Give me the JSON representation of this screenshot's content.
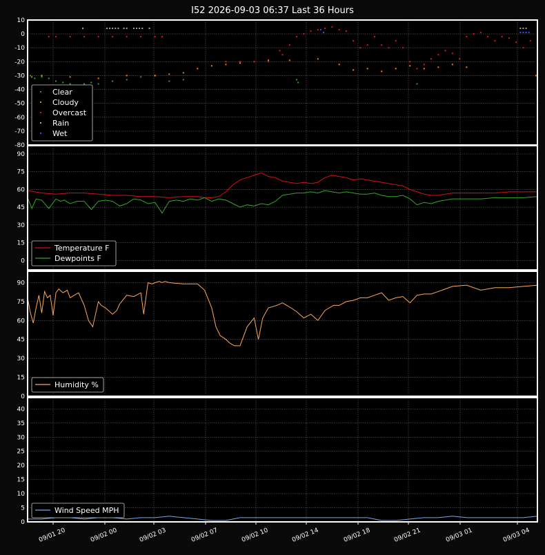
{
  "title": "I52 2026-09-03 06:37 Last 36 Hours",
  "x_ticks": [
    "09/01 20",
    "09/02 00",
    "09/02 03",
    "09/02 07",
    "09/02 10",
    "09/02 14",
    "09/02 18",
    "09/02 21",
    "09/03 01",
    "09/03 04"
  ],
  "chart_data": [
    {
      "type": "scatter",
      "ylim": [
        -80,
        10
      ],
      "yticks": [
        10,
        0,
        -10,
        -20,
        -30,
        -40,
        -50,
        -60,
        -70,
        -80
      ],
      "legend": "lower-left",
      "grid": true,
      "series": [
        {
          "name": "Clear",
          "color": "#22aa22",
          "points": [
            [
              0,
              -31
            ],
            [
              0.2,
              -30
            ],
            [
              0.5,
              -32
            ],
            [
              1,
              -31
            ],
            [
              1.5,
              -32
            ],
            [
              2,
              -34
            ],
            [
              2.5,
              -35
            ],
            [
              3,
              -36
            ],
            [
              3.5,
              -37
            ],
            [
              4,
              -36
            ],
            [
              4.5,
              -35
            ],
            [
              5,
              -36
            ],
            [
              6,
              -34
            ],
            [
              7,
              -33
            ],
            [
              8,
              -31
            ],
            [
              9,
              -30
            ],
            [
              10,
              -34
            ],
            [
              11,
              -33
            ],
            [
              19,
              -33
            ],
            [
              19.1,
              -35
            ],
            [
              27.5,
              -36
            ]
          ]
        },
        {
          "name": "Cloudy",
          "color": "#ff7f0e",
          "points": [
            [
              0,
              -30
            ],
            [
              0.3,
              -31
            ],
            [
              1,
              -30
            ],
            [
              3,
              -31
            ],
            [
              5,
              -32
            ],
            [
              7,
              -30
            ],
            [
              9,
              -30
            ],
            [
              10,
              -29
            ],
            [
              11,
              -28
            ],
            [
              12,
              -25
            ],
            [
              13,
              -23
            ],
            [
              14,
              -22
            ],
            [
              15,
              -21
            ],
            [
              16,
              -20
            ],
            [
              17,
              -19
            ],
            [
              18.5,
              -19
            ],
            [
              20.5,
              -18
            ],
            [
              22,
              -22
            ],
            [
              23,
              -26
            ],
            [
              24,
              -25
            ],
            [
              25,
              -27
            ],
            [
              26,
              -25
            ],
            [
              27,
              -23
            ],
            [
              28,
              -25
            ],
            [
              29,
              -24
            ],
            [
              30,
              -22
            ],
            [
              31,
              -24
            ],
            [
              35.9,
              -30
            ]
          ]
        },
        {
          "name": "Overcast",
          "color": "#ee1111",
          "points": [
            [
              1.5,
              -2
            ],
            [
              2,
              -2
            ],
            [
              3,
              -2
            ],
            [
              4,
              -2
            ],
            [
              5,
              -2
            ],
            [
              6,
              -2
            ],
            [
              7,
              -2
            ],
            [
              8,
              -2
            ],
            [
              9,
              -2
            ],
            [
              9.5,
              -2
            ],
            [
              14,
              -20
            ],
            [
              15,
              -20
            ],
            [
              16,
              -20
            ],
            [
              17,
              -20
            ],
            [
              17.8,
              -12
            ],
            [
              18,
              -15
            ],
            [
              18.5,
              -8
            ],
            [
              19,
              -2
            ],
            [
              19.5,
              0
            ],
            [
              20,
              2
            ],
            [
              20.5,
              3
            ],
            [
              21,
              4
            ],
            [
              21.5,
              5
            ],
            [
              22,
              3
            ],
            [
              22.5,
              2
            ],
            [
              23,
              -5
            ],
            [
              23.5,
              -10
            ],
            [
              24,
              -8
            ],
            [
              24.5,
              -2
            ],
            [
              25,
              -8
            ],
            [
              25.5,
              -10
            ],
            [
              26,
              -5
            ],
            [
              26.5,
              -10
            ],
            [
              27,
              -20
            ],
            [
              27.5,
              -25
            ],
            [
              28,
              -22
            ],
            [
              28.5,
              -18
            ],
            [
              29,
              -15
            ],
            [
              29.5,
              -12
            ],
            [
              30,
              -14
            ],
            [
              30.5,
              -18
            ],
            [
              31,
              -2
            ],
            [
              31.5,
              0
            ],
            [
              32,
              1
            ],
            [
              32.5,
              -2
            ],
            [
              33,
              -5
            ],
            [
              33.5,
              -2
            ],
            [
              34,
              -3
            ],
            [
              34.5,
              -6
            ],
            [
              35,
              -10
            ],
            [
              35.5,
              -5
            ],
            [
              36,
              -3
            ]
          ]
        },
        {
          "name": "Rain",
          "color": "#aaaaaa",
          "points": [
            [
              3.9,
              4
            ],
            [
              5.6,
              4
            ],
            [
              5.8,
              4
            ],
            [
              6,
              4
            ],
            [
              6.2,
              4
            ],
            [
              6.4,
              4
            ],
            [
              6.8,
              4
            ],
            [
              7.0,
              4
            ],
            [
              7.5,
              4
            ],
            [
              7.7,
              4
            ],
            [
              7.9,
              4
            ],
            [
              8.1,
              4
            ],
            [
              8.6,
              4
            ],
            [
              34.8,
              4
            ],
            [
              35.0,
              4
            ],
            [
              35.2,
              4
            ]
          ]
        },
        {
          "name": "Wet",
          "color": "#3355ff",
          "points": [
            [
              20.7,
              3
            ],
            [
              20.9,
              1
            ],
            [
              34.8,
              1
            ],
            [
              35.0,
              1
            ],
            [
              35.2,
              1
            ],
            [
              35.4,
              1
            ]
          ]
        }
      ]
    },
    {
      "type": "line",
      "ylim": [
        -8,
        97
      ],
      "yticks": [
        90,
        75,
        60,
        45,
        30,
        15,
        0
      ],
      "legend": "lower-left",
      "grid": true,
      "series": [
        {
          "name": "Temperature F",
          "color": "#dd1111",
          "x": [
            0,
            1,
            2,
            3,
            4,
            5,
            6,
            7,
            8,
            9,
            10,
            11,
            12,
            12.5,
            13,
            13.5,
            14,
            14.5,
            15,
            15.5,
            16,
            16.5,
            17,
            17.5,
            18,
            18.5,
            19,
            19.5,
            20,
            20.5,
            21,
            21.5,
            22,
            22.5,
            23,
            23.5,
            24,
            24.5,
            25,
            25.5,
            26,
            26.5,
            27,
            27.5,
            28,
            28.5,
            29,
            29.5,
            30,
            31,
            32,
            33,
            34,
            35,
            36
          ],
          "values": [
            59,
            57,
            56,
            57,
            57,
            56,
            55,
            55,
            54,
            54,
            53,
            54,
            54,
            53,
            53,
            54,
            58,
            64,
            68,
            70,
            72,
            74,
            71,
            70,
            67,
            66,
            65,
            66,
            65,
            66,
            70,
            72,
            71,
            70,
            68,
            69,
            68,
            67,
            66,
            65,
            64,
            63,
            60,
            58,
            56,
            55,
            55,
            56,
            57,
            57,
            57,
            57,
            58,
            58,
            58
          ]
        },
        {
          "name": "Dewpoints F",
          "color": "#33aa22",
          "x": [
            0,
            0.3,
            0.6,
            1,
            1.5,
            2,
            2.3,
            2.6,
            3,
            3.5,
            4,
            4.5,
            5,
            5.5,
            6,
            6.5,
            7,
            7.5,
            8,
            8.5,
            9,
            9.5,
            10,
            10.5,
            11,
            11.5,
            12,
            12.5,
            13,
            13.5,
            14,
            14.5,
            15,
            15.5,
            16,
            16.5,
            17,
            17.5,
            18,
            18.5,
            19,
            19.5,
            20,
            20.5,
            21,
            21.5,
            22,
            22.5,
            23,
            23.5,
            24,
            24.5,
            25,
            25.5,
            26,
            26.5,
            27,
            27.5,
            28,
            28.5,
            29,
            29.5,
            30,
            31,
            32,
            33,
            34,
            35,
            36
          ],
          "values": [
            53,
            44,
            52,
            51,
            44,
            52,
            50,
            51,
            48,
            50,
            50,
            43,
            50,
            51,
            50,
            46,
            48,
            52,
            51,
            48,
            49,
            40,
            50,
            51,
            50,
            52,
            51,
            53,
            50,
            52,
            51,
            48,
            45,
            47,
            46,
            48,
            47,
            50,
            55,
            56,
            57,
            57,
            58,
            57,
            59,
            58,
            57,
            58,
            57,
            56,
            56,
            57,
            55,
            54,
            54,
            55,
            52,
            47,
            49,
            48,
            50,
            51,
            52,
            52,
            52,
            53,
            53,
            53,
            54
          ]
        }
      ]
    },
    {
      "type": "line",
      "ylim": [
        0,
        99
      ],
      "yticks": [
        90,
        75,
        60,
        45,
        30,
        15,
        0
      ],
      "legend": "lower-left",
      "grid": true,
      "series": [
        {
          "name": "Humidity %",
          "color": "#ffaa55",
          "x": [
            0,
            0.2,
            0.4,
            0.6,
            0.8,
            1,
            1.2,
            1.4,
            1.6,
            1.8,
            2,
            2.2,
            2.5,
            2.8,
            3,
            3.3,
            3.6,
            4,
            4.3,
            4.6,
            5,
            5.2,
            5.5,
            6,
            6.3,
            6.5,
            7,
            7.5,
            8,
            8.2,
            8.5,
            8.8,
            9,
            9.3,
            9.5,
            9.7,
            10,
            11,
            12,
            12.5,
            13,
            13.3,
            13.6,
            14,
            14.3,
            14.6,
            15,
            15.5,
            16,
            16.3,
            16.6,
            17,
            17.3,
            17.6,
            18,
            18.3,
            18.6,
            19,
            19.5,
            20,
            20.5,
            21,
            21.3,
            21.6,
            22,
            22.5,
            23,
            23.5,
            24,
            24.5,
            25,
            25.5,
            26,
            26.5,
            27,
            27.5,
            28,
            28.5,
            29,
            29.5,
            30,
            31,
            32,
            33,
            34,
            35,
            36
          ],
          "values": [
            78,
            66,
            58,
            70,
            80,
            66,
            83,
            78,
            80,
            64,
            82,
            85,
            82,
            84,
            78,
            80,
            82,
            72,
            60,
            55,
            75,
            72,
            70,
            65,
            68,
            73,
            80,
            79,
            82,
            65,
            90,
            89,
            90,
            91,
            90,
            91,
            90,
            89,
            89,
            84,
            70,
            55,
            48,
            45,
            42,
            40,
            40,
            55,
            62,
            45,
            62,
            70,
            71,
            72,
            74,
            72,
            70,
            67,
            62,
            65,
            60,
            68,
            70,
            72,
            72,
            75,
            76,
            78,
            78,
            80,
            82,
            76,
            78,
            79,
            74,
            80,
            81,
            81,
            83,
            85,
            87,
            88,
            84,
            86,
            86,
            87,
            88
          ]
        }
      ]
    },
    {
      "type": "line",
      "ylim": [
        0,
        44
      ],
      "yticks": [
        40,
        35,
        30,
        25,
        20,
        15,
        10,
        5,
        0
      ],
      "legend": "lower-left",
      "grid": true,
      "series": [
        {
          "name": "Wind Speed MPH",
          "color": "#77aaee",
          "x": [
            0,
            1,
            2,
            3,
            4,
            5,
            6,
            7,
            8,
            9,
            10,
            11,
            12,
            13,
            14,
            15,
            16,
            17,
            18,
            19,
            20,
            21,
            22,
            23,
            24,
            25,
            26,
            27,
            28,
            29,
            30,
            31,
            32,
            33,
            34,
            35,
            36
          ],
          "values": [
            1,
            1,
            1.5,
            1.5,
            1,
            1.5,
            1.5,
            1,
            1.5,
            1.5,
            2,
            1.5,
            1,
            0.5,
            0.5,
            1.5,
            1.5,
            1.5,
            1.5,
            1.5,
            1.5,
            1.5,
            1.5,
            1.5,
            1.5,
            0.5,
            0.5,
            1,
            1.5,
            1.5,
            2,
            1.5,
            1.5,
            1.5,
            1.5,
            1.5,
            2
          ]
        }
      ]
    }
  ]
}
